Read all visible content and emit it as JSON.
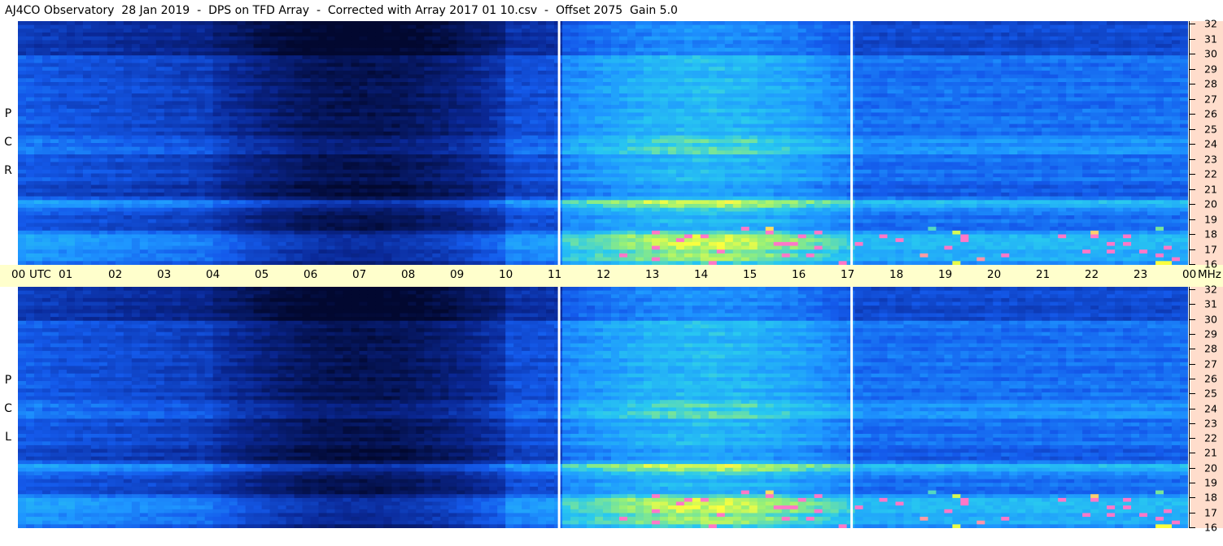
{
  "title": "AJ4CO Observatory  28 Jan 2019  -  DPS on TFD Array  -  Corrected with Array 2017 01 10.csv  -  Offset 2075  Gain 5.0",
  "panels": {
    "top": {
      "polarization": [
        "R",
        "C",
        "P"
      ]
    },
    "bottom": {
      "polarization": [
        "L",
        "C",
        "P"
      ]
    }
  },
  "time_axis": {
    "labels": [
      "00",
      "UTC",
      "01",
      "02",
      "03",
      "04",
      "05",
      "06",
      "07",
      "08",
      "09",
      "10",
      "11",
      "12",
      "13",
      "14",
      "15",
      "16",
      "17",
      "18",
      "19",
      "20",
      "21",
      "22",
      "23",
      "00",
      "MHz"
    ]
  },
  "colors": {
    "low": "#000a38",
    "mid": "#1a6dff",
    "high": "#ffff33",
    "axis_bg": "#ffffcc",
    "freq_bg": "#ffddcc"
  },
  "chart_data": {
    "type": "heatmap",
    "x": {
      "label": "UTC",
      "range": [
        0,
        24
      ],
      "ticks": [
        "00",
        "01",
        "02",
        "03",
        "04",
        "05",
        "06",
        "07",
        "08",
        "09",
        "10",
        "11",
        "12",
        "13",
        "14",
        "15",
        "16",
        "17",
        "18",
        "19",
        "20",
        "21",
        "22",
        "23",
        "00"
      ]
    },
    "y": {
      "label": "MHz",
      "range": [
        16,
        32
      ],
      "ticks": [
        "16",
        "17",
        "18",
        "19",
        "20",
        "21",
        "22",
        "23",
        "24",
        "25",
        "26",
        "27",
        "28",
        "29",
        "30",
        "31",
        "32"
      ]
    },
    "series": [
      {
        "name": "RCP",
        "dark_interval_utc": [
          4,
          10
        ],
        "white_markers_utc": [
          11.1,
          17.1
        ],
        "bright_bands_mhz": [
          16.5,
          17.2,
          17.8,
          20
        ]
      },
      {
        "name": "LCP",
        "dark_interval_utc": [
          4,
          10
        ],
        "white_markers_utc": [
          11.1,
          17.1
        ],
        "bright_bands_mhz": [
          16.5,
          17.2,
          17.8,
          20
        ]
      }
    ]
  }
}
